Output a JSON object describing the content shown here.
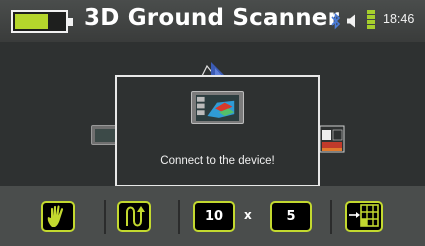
{
  "header": {
    "title": "3D Ground Scanner",
    "time": "18:46",
    "battery_level": 0.7,
    "icons": [
      "battery-icon",
      "bluetooth-icon",
      "speaker-icon",
      "battery-vertical-icon"
    ]
  },
  "dialog": {
    "message": "Connect to the device!"
  },
  "toolbar": {
    "field_width": "10",
    "times_symbol": "x",
    "field_length": "5",
    "icons": [
      "hand-icon",
      "zigzag-path-icon",
      "grid-size-icon"
    ]
  },
  "colors": {
    "accent": "#c3d92f",
    "header_bg": "#4a4d4c",
    "main_bg": "#2e3131",
    "battery_fill": "#b5d62c"
  }
}
